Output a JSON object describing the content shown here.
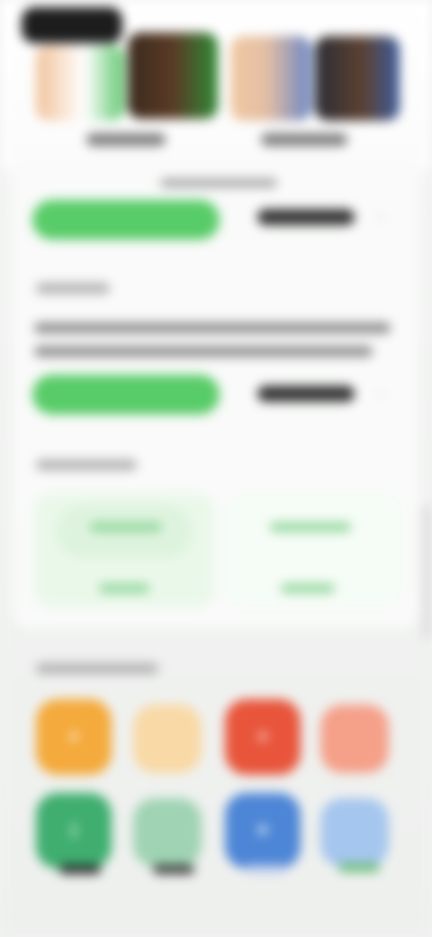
{
  "header": {
    "back_label": ""
  },
  "featured": {
    "items": [
      {
        "label": ""
      },
      {
        "label": ""
      },
      {
        "label": ""
      },
      {
        "label": ""
      }
    ]
  },
  "card": {
    "caption": "",
    "primary_button_1": "",
    "secondary_button_1": "",
    "section_1_title": "",
    "description_line_1": "",
    "description_line_2": "",
    "primary_button_2": "",
    "secondary_button_2": "",
    "section_2_title": "",
    "tiles": [
      {
        "title": "",
        "subtitle": ""
      },
      {
        "title": "",
        "subtitle": ""
      }
    ]
  },
  "apps": {
    "section_title": "",
    "icons": [
      {
        "icon": "app-orange-icon",
        "color": "#f4aa3c",
        "label": ""
      },
      {
        "icon": "app-peach-icon",
        "color": "#f9d9a6",
        "label": ""
      },
      {
        "icon": "app-red-icon",
        "color": "#e8553b",
        "label": ""
      },
      {
        "icon": "app-salmon-icon",
        "color": "#f5a089",
        "label": ""
      },
      {
        "icon": "app-green-icon",
        "color": "#3fae6f",
        "label": ""
      },
      {
        "icon": "app-mint-icon",
        "color": "#9fd3b3",
        "label": ""
      },
      {
        "icon": "app-blue-icon",
        "color": "#4d86d6",
        "label": ""
      },
      {
        "icon": "app-lightblue-icon",
        "color": "#a5c6ee",
        "label": ""
      }
    ]
  },
  "colors": {
    "accent_green": "#58cc68",
    "background": "#f1f2f1"
  }
}
